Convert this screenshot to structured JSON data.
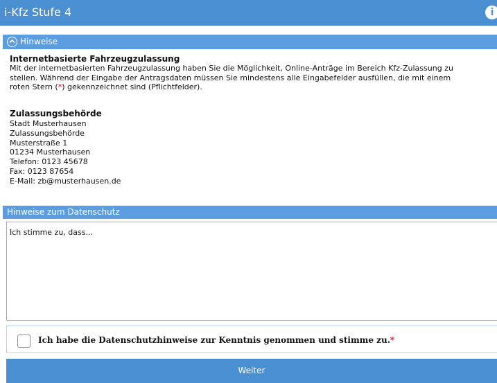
{
  "header": {
    "title": "i-Kfz Stufe 4",
    "info_icon": "info-icon"
  },
  "hinweise": {
    "toggle_label": "Hinweise",
    "toggle_icon": "chevron-up-circle-icon",
    "intro_heading": "Internetbasierte Fahrzeugzulassung",
    "intro_line1": "Mit der internetbasierten Fahrzeugzulassung haben Sie die Möglichkeit, Online-Anträge im Bereich Kfz-Zulassung zu",
    "intro_line2": "stellen. Während der Eingabe der Antragsdaten müssen Sie mindestens alle Eingabefelder ausfüllen, die mit einem",
    "intro_line3_pre": "roten Stern (",
    "required_marker": "*",
    "intro_line3_post": ") gekennzeichnet sind (Pflichtfelder).",
    "authority_heading": "Zulassungsbehörde",
    "authority_lines": [
      "Stadt Musterhausen",
      "Zulassungsbehörde",
      "Musterstraße 1",
      "01234 Musterhausen",
      "Telefon: 0123 45678",
      "Fax: 0123 87654",
      "E-Mail: zb@musterhausen.de"
    ]
  },
  "datenschutz": {
    "section_label": "Hinweise zum Datenschutz",
    "consent_text": "Ich stimme zu, dass...",
    "checkbox_label": "Ich habe die Datenschutzhinweise zur Kenntnis genommen und stimme zu.",
    "checkbox_required": "*",
    "checked": false
  },
  "actions": {
    "next_label": "Weiter"
  },
  "colors": {
    "accent": "#4b8fd3",
    "section_bar": "#5b9de0",
    "required": "#d0021b"
  }
}
